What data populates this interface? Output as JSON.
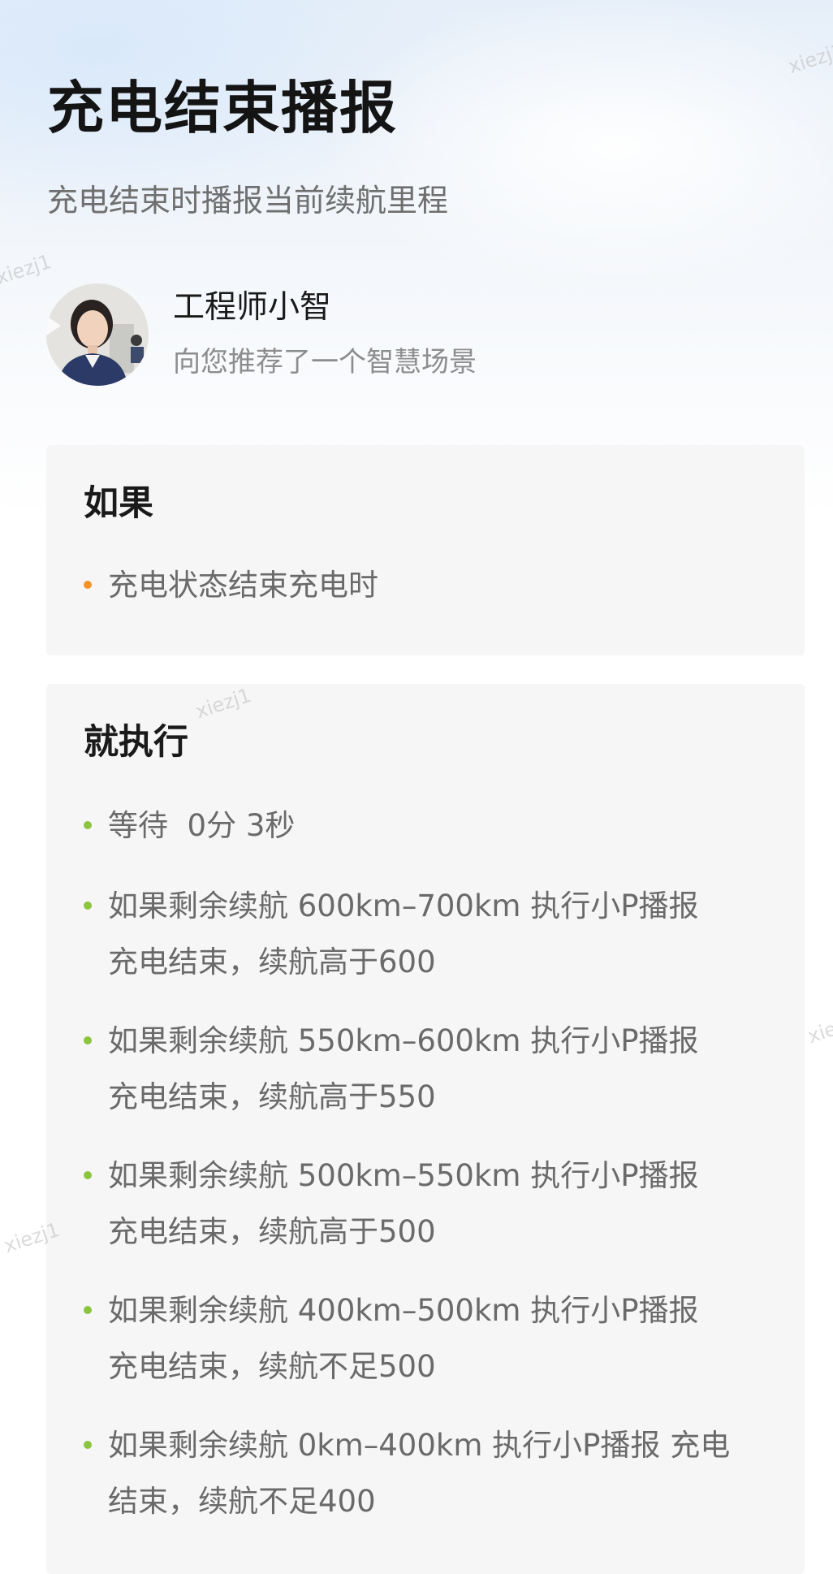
{
  "header": {
    "title": "充电结束播报",
    "subtitle": "充电结束时播报当前续航里程"
  },
  "author": {
    "name": "工程师小智",
    "note": "向您推荐了一个智慧场景"
  },
  "condition": {
    "heading": "如果",
    "bullet_color": "#f5922a",
    "items": [
      "充电状态结束充电时"
    ]
  },
  "actions": {
    "heading": "就执行",
    "bullet_color": "#8cc43f",
    "items": [
      "等待  0分 3秒",
      "如果剩余续航 600km–700km  执行小P播报 充电结束，续航高于600",
      "如果剩余续航 550km–600km  执行小P播报 充电结束，续航高于550",
      "如果剩余续航 500km–550km  执行小P播报 充电结束，续航高于500",
      "如果剩余续航 400km–500km  执行小P播报 充电结束，续航不足500",
      "如果剩余续航 0km–400km  执行小P播报 充电结束，续航不足400"
    ]
  },
  "watermark": "xiezj1"
}
